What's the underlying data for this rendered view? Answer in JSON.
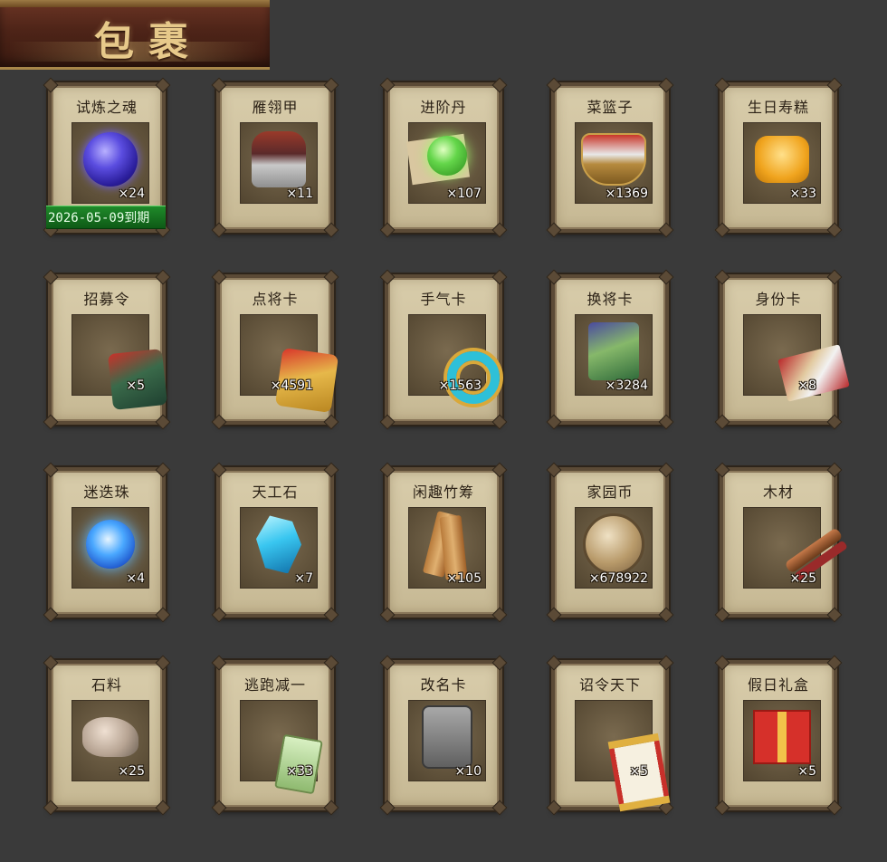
{
  "window": {
    "title": "包裹"
  },
  "items": [
    {
      "name": "试炼之魂",
      "qty": "×24",
      "icon": "soul-orb-icon",
      "expire": "2026-05-09到期"
    },
    {
      "name": "雁翎甲",
      "qty": "×11",
      "icon": "armor-icon"
    },
    {
      "name": "进阶丹",
      "qty": "×107",
      "icon": "green-pill-icon"
    },
    {
      "name": "菜篮子",
      "qty": "×1369",
      "icon": "basket-icon"
    },
    {
      "name": "生日寿糕",
      "qty": "×33",
      "icon": "cake-icon"
    },
    {
      "name": "招募令",
      "qty": "×5",
      "icon": "recruit-token-icon"
    },
    {
      "name": "点将卡",
      "qty": "×4591",
      "icon": "general-card-icon"
    },
    {
      "name": "手气卡",
      "qty": "×1563",
      "icon": "luck-card-icon"
    },
    {
      "name": "换将卡",
      "qty": "×3284",
      "icon": "swap-card-icon"
    },
    {
      "name": "身份卡",
      "qty": "×8",
      "icon": "identity-card-icon"
    },
    {
      "name": "迷迭珠",
      "qty": "×4",
      "icon": "blue-orb-icon"
    },
    {
      "name": "天工石",
      "qty": "×7",
      "icon": "crystal-icon"
    },
    {
      "name": "闲趣竹筹",
      "qty": "×105",
      "icon": "bamboo-sticks-icon"
    },
    {
      "name": "家园币",
      "qty": "×678922",
      "icon": "coin-icon"
    },
    {
      "name": "木材",
      "qty": "×25",
      "icon": "wood-icon"
    },
    {
      "name": "石料",
      "qty": "×25",
      "icon": "stone-icon"
    },
    {
      "name": "逃跑减一",
      "qty": "×33",
      "icon": "jade-tag-icon"
    },
    {
      "name": "改名卡",
      "qty": "×10",
      "icon": "rename-card-icon"
    },
    {
      "name": "诏令天下",
      "qty": "×5",
      "icon": "edict-scroll-icon"
    },
    {
      "name": "假日礼盒",
      "qty": "×5",
      "icon": "gift-box-icon"
    }
  ]
}
